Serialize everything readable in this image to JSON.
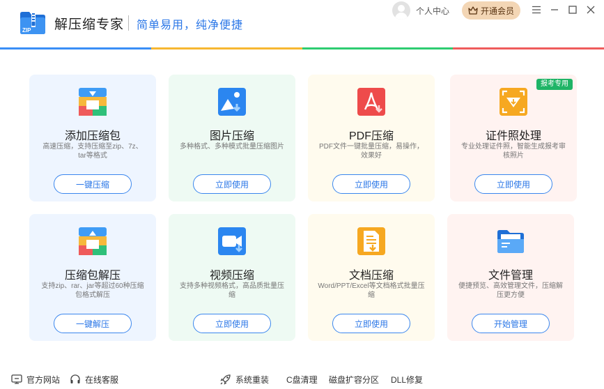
{
  "app": {
    "title": "解压缩专家",
    "slogan": "简单易用，纯净便捷",
    "logo_text": "ZIP"
  },
  "header": {
    "user_label": "个人中心",
    "vip_label": "开通会员",
    "icons": [
      "avatar-icon",
      "crown-icon",
      "menu-icon",
      "minimize-icon",
      "maximize-icon",
      "close-icon"
    ]
  },
  "colors": {
    "accent": "#2b77e7",
    "rainbow": [
      "#3a8ef6",
      "#f7b731",
      "#2ecc71",
      "#ef5b5b"
    ]
  },
  "cards": [
    {
      "title": "添加压缩包",
      "desc": "高速压缩，支持压缩至zip、7z、tar等格式",
      "button": "一键压缩"
    },
    {
      "title": "图片压缩",
      "desc": "多种格式、多种模式批量压缩图片",
      "button": "立即使用"
    },
    {
      "title": "PDF压缩",
      "desc": "PDF文件一键批量压缩，易操作，效果好",
      "button": "立即使用"
    },
    {
      "title": "证件照处理",
      "desc": "专业处理证件照，智能生成报考审核照片",
      "button": "立即使用",
      "badge": "报考专用"
    },
    {
      "title": "压缩包解压",
      "desc": "支持zip、rar、jar等超过60种压缩包格式解压",
      "button": "一键解压"
    },
    {
      "title": "视频压缩",
      "desc": "支持多种视频格式，高品质批量压缩",
      "button": "立即使用"
    },
    {
      "title": "文档压缩",
      "desc": "Word/PPT/Excel等文档格式批量压缩",
      "button": "立即使用"
    },
    {
      "title": "文件管理",
      "desc": "便捷预览、高效管理文件，压缩解压更方便",
      "button": "开始管理"
    }
  ],
  "footer": {
    "website": "官方网站",
    "support": "在线客服",
    "reinstall": "系统重装",
    "cclean": "C盘清理",
    "partition": "磁盘扩容分区",
    "dll": "DLL修复"
  }
}
